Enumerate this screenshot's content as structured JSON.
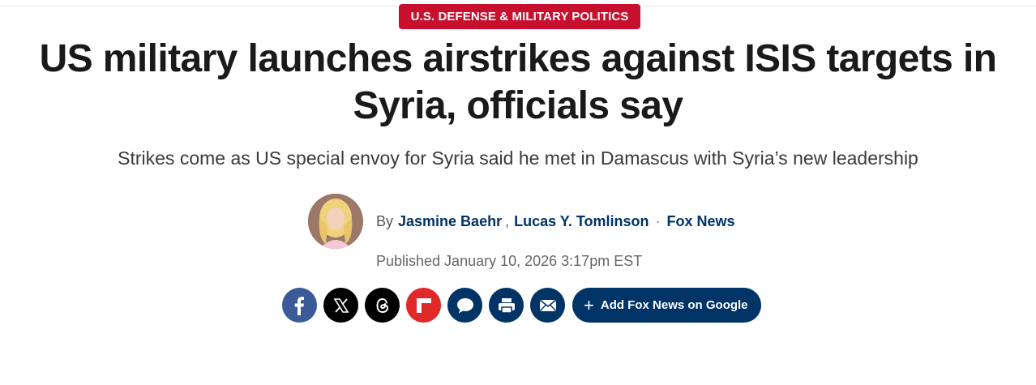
{
  "category": {
    "label": "U.S. DEFENSE & MILITARY POLITICS"
  },
  "article": {
    "headline_line1": "US military launches airstrikes against ISIS targets in",
    "headline_line2": "Syria, officials say",
    "subhead": "Strikes come as US special envoy for Syria said he met in Damascus with Syria’s new leadership"
  },
  "byline": {
    "prefix": "By",
    "authors": [
      "Jasmine Baehr",
      "Lucas Y. Tomlinson"
    ],
    "separator": ",",
    "dot": "·",
    "source": "Fox News",
    "published": "Published January 10, 2026 3:17pm EST"
  },
  "share": {
    "buttons": [
      {
        "icon": "facebook-icon",
        "color": "#3b5b98"
      },
      {
        "icon": "x-icon",
        "color": "#000000"
      },
      {
        "icon": "threads-icon",
        "color": "#000000"
      },
      {
        "icon": "flipboard-icon",
        "color": "#e12828"
      },
      {
        "icon": "comment-icon",
        "color": "#003366"
      },
      {
        "icon": "print-icon",
        "color": "#003366"
      },
      {
        "icon": "email-icon",
        "color": "#003366"
      }
    ],
    "google_label": "Add Fox News on Google",
    "google_plus": "+"
  },
  "colors": {
    "brand_red": "#c8102e",
    "brand_navy": "#003366",
    "headline": "#1a1a1a"
  }
}
